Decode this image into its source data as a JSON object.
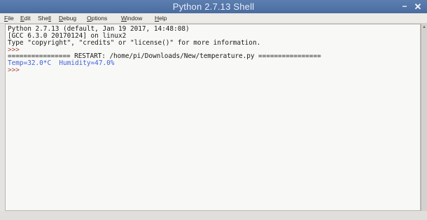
{
  "window": {
    "title": "Python 2.7.13 Shell",
    "minimize_label": "−",
    "close_label": "✕"
  },
  "menubar": {
    "items": [
      {
        "accel": "F",
        "rest": "ile"
      },
      {
        "accel": "E",
        "rest": "dit"
      },
      {
        "accel": "She",
        "rest": "ll",
        "accel_last": true
      },
      {
        "accel": "D",
        "rest": "ebug"
      },
      {
        "accel": "O",
        "rest": "ptions"
      },
      {
        "accel": "W",
        "rest": "indow"
      },
      {
        "accel": "H",
        "rest": "elp"
      }
    ]
  },
  "shell": {
    "lines": [
      "Python 2.7.13 (default, Jan 19 2017, 14:48:08)",
      "[GCC 6.3.0 20170124] on linux2",
      "Type \"copyright\", \"credits\" or \"license()\" for more information.",
      ">>> ",
      "================ RESTART: /home/pi/Downloads/New/temperature.py ================",
      "Temp=32.0*C  Humidity=47.0%",
      ">>> "
    ]
  },
  "colors": {
    "output": "#3f63d8",
    "prompt": "#a44b3e",
    "titlebar": "#4a6c9f"
  }
}
